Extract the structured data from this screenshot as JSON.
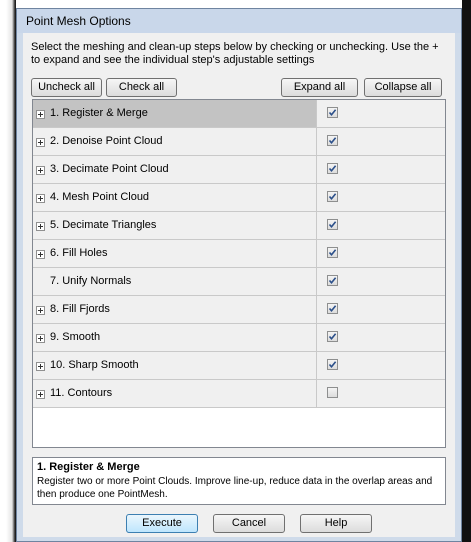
{
  "window": {
    "title": "Point Mesh Options"
  },
  "instructions": "Select the meshing and clean-up steps below by checking or unchecking. Use the + to expand and see the individual step's adjustable settings",
  "toolbar": {
    "uncheck_all": "Uncheck all",
    "check_all": "Check all",
    "expand_all": "Expand all",
    "collapse_all": "Collapse all"
  },
  "steps": [
    {
      "label": "1. Register & Merge",
      "checked": true,
      "expandable": true,
      "selected": true
    },
    {
      "label": "2. Denoise Point Cloud",
      "checked": true,
      "expandable": true
    },
    {
      "label": "3. Decimate Point Cloud",
      "checked": true,
      "expandable": true
    },
    {
      "label": "4. Mesh Point Cloud",
      "checked": true,
      "expandable": true
    },
    {
      "label": "5. Decimate Triangles",
      "checked": true,
      "expandable": true
    },
    {
      "label": "6. Fill Holes",
      "checked": true,
      "expandable": true
    },
    {
      "label": "7. Unify Normals",
      "checked": true,
      "expandable": false
    },
    {
      "label": "8. Fill Fjords",
      "checked": true,
      "expandable": true
    },
    {
      "label": "9. Smooth",
      "checked": true,
      "expandable": true
    },
    {
      "label": "10. Sharp Smooth",
      "checked": true,
      "expandable": true
    },
    {
      "label": "11. Contours",
      "checked": false,
      "expandable": true
    }
  ],
  "details": {
    "title": "1. Register & Merge",
    "body": "Register two or more Point Clouds. Improve line-up, reduce data in the overlap areas and then produce one PointMesh."
  },
  "footer": {
    "execute": "Execute",
    "cancel": "Cancel",
    "help": "Help"
  },
  "icons": {
    "expander": "plus-box-icon",
    "checkbox": "checkmark-icon"
  },
  "colors": {
    "selected_row": "#c3c3c3",
    "titlebar": "#c9d7ea",
    "primary_button": "#bee6fd"
  }
}
